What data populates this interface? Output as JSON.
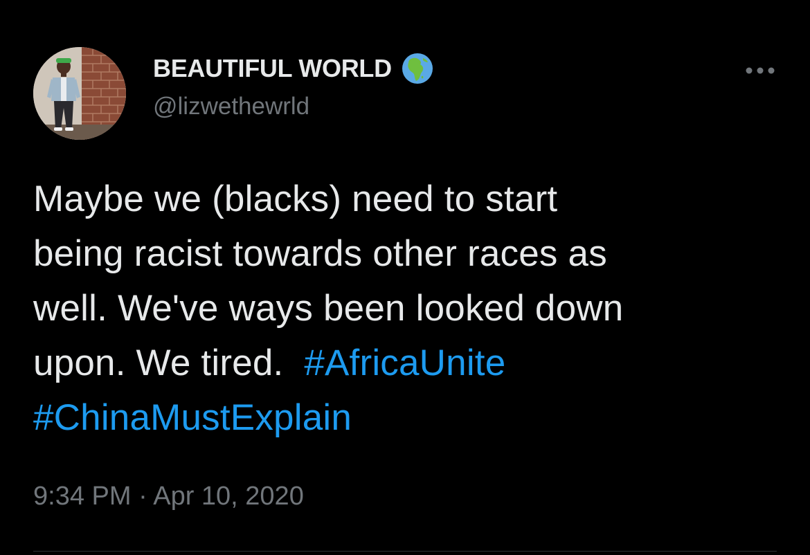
{
  "author": {
    "display_name": "BEAUTIFUL WORLD",
    "handle": "@lizwethewrld",
    "badge_icon": "globe-africa-icon",
    "avatar_icon": "profile-photo-avatar"
  },
  "tweet": {
    "lines": [
      {
        "text": "Maybe we (blacks) need to start"
      },
      {
        "text": "being racist towards other races as"
      },
      {
        "text": "well. We've ways been looked down"
      },
      {
        "text": "upon. We tired.  ",
        "hashtag": "#AfricaUnite"
      },
      {
        "text": "",
        "hashtag": "#ChinaMustExplain"
      }
    ],
    "time": "9:34 PM",
    "separator": "·",
    "date": "Apr 10, 2020"
  },
  "menu": {
    "more_icon": "more-options-icon"
  },
  "colors": {
    "background": "#000000",
    "primary_text": "#e7e9ea",
    "secondary_text": "#71767b",
    "hashtag": "#1d9bf0",
    "divider": "#2f3336"
  }
}
